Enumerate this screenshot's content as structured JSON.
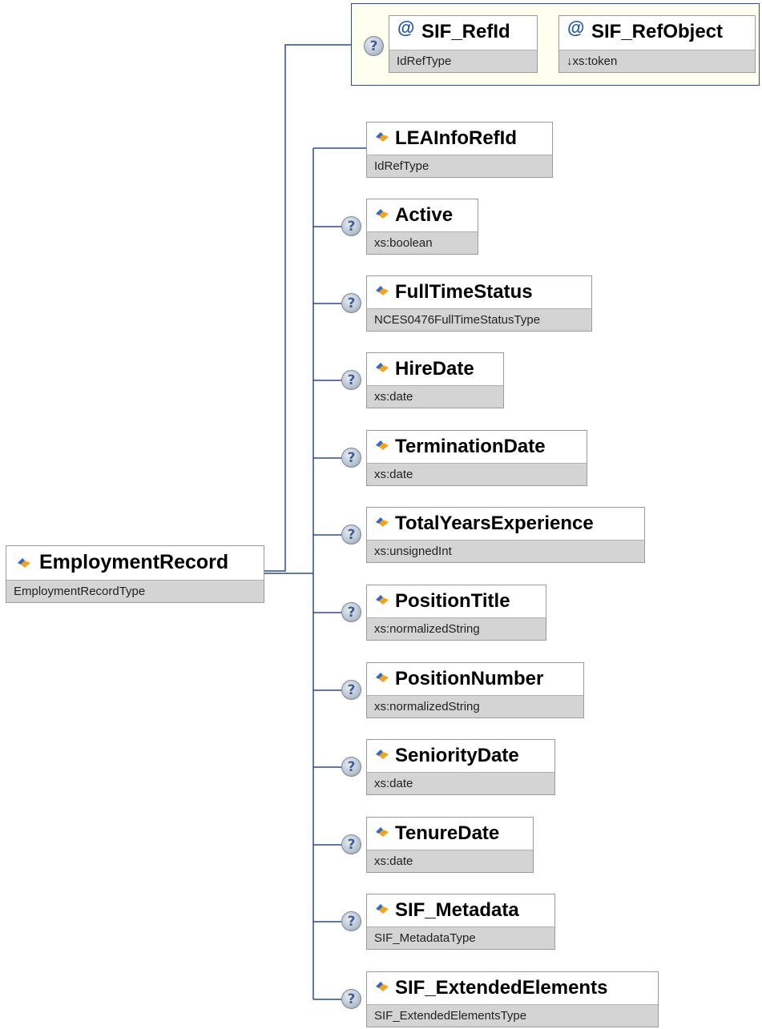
{
  "root": {
    "name": "EmploymentRecord",
    "type": "EmploymentRecordType"
  },
  "attributes": [
    {
      "name": "SIF_RefId",
      "type": "IdRefType",
      "optional": true
    },
    {
      "name": "SIF_RefObject",
      "type": "↓xs:token",
      "optional": false
    }
  ],
  "elements": [
    {
      "name": "LEAInfoRefId",
      "type": "IdRefType",
      "optional": false
    },
    {
      "name": "Active",
      "type": "xs:boolean",
      "optional": true
    },
    {
      "name": "FullTimeStatus",
      "type": "NCES0476FullTimeStatusType",
      "optional": true
    },
    {
      "name": "HireDate",
      "type": "xs:date",
      "optional": true
    },
    {
      "name": "TerminationDate",
      "type": "xs:date",
      "optional": true
    },
    {
      "name": "TotalYearsExperience",
      "type": "xs:unsignedInt",
      "optional": true
    },
    {
      "name": "PositionTitle",
      "type": "xs:normalizedString",
      "optional": true
    },
    {
      "name": "PositionNumber",
      "type": "xs:normalizedString",
      "optional": true
    },
    {
      "name": "SeniorityDate",
      "type": "xs:date",
      "optional": true
    },
    {
      "name": "TenureDate",
      "type": "xs:date",
      "optional": true
    },
    {
      "name": "SIF_Metadata",
      "type": "SIF_MetadataType",
      "optional": true
    },
    {
      "name": "SIF_ExtendedElements",
      "type": "SIF_ExtendedElementsType",
      "optional": true
    }
  ],
  "colors": {
    "connector": "#2b4a8a",
    "icon_blue": "#3a67b7",
    "icon_orange": "#f2a41c",
    "type_bar": "#d4d4d4",
    "attr_group_bg": "#fffff0"
  },
  "icons": {
    "element": "element-icon",
    "attribute": "attribute-at-icon",
    "optional": "optional-question-icon"
  }
}
